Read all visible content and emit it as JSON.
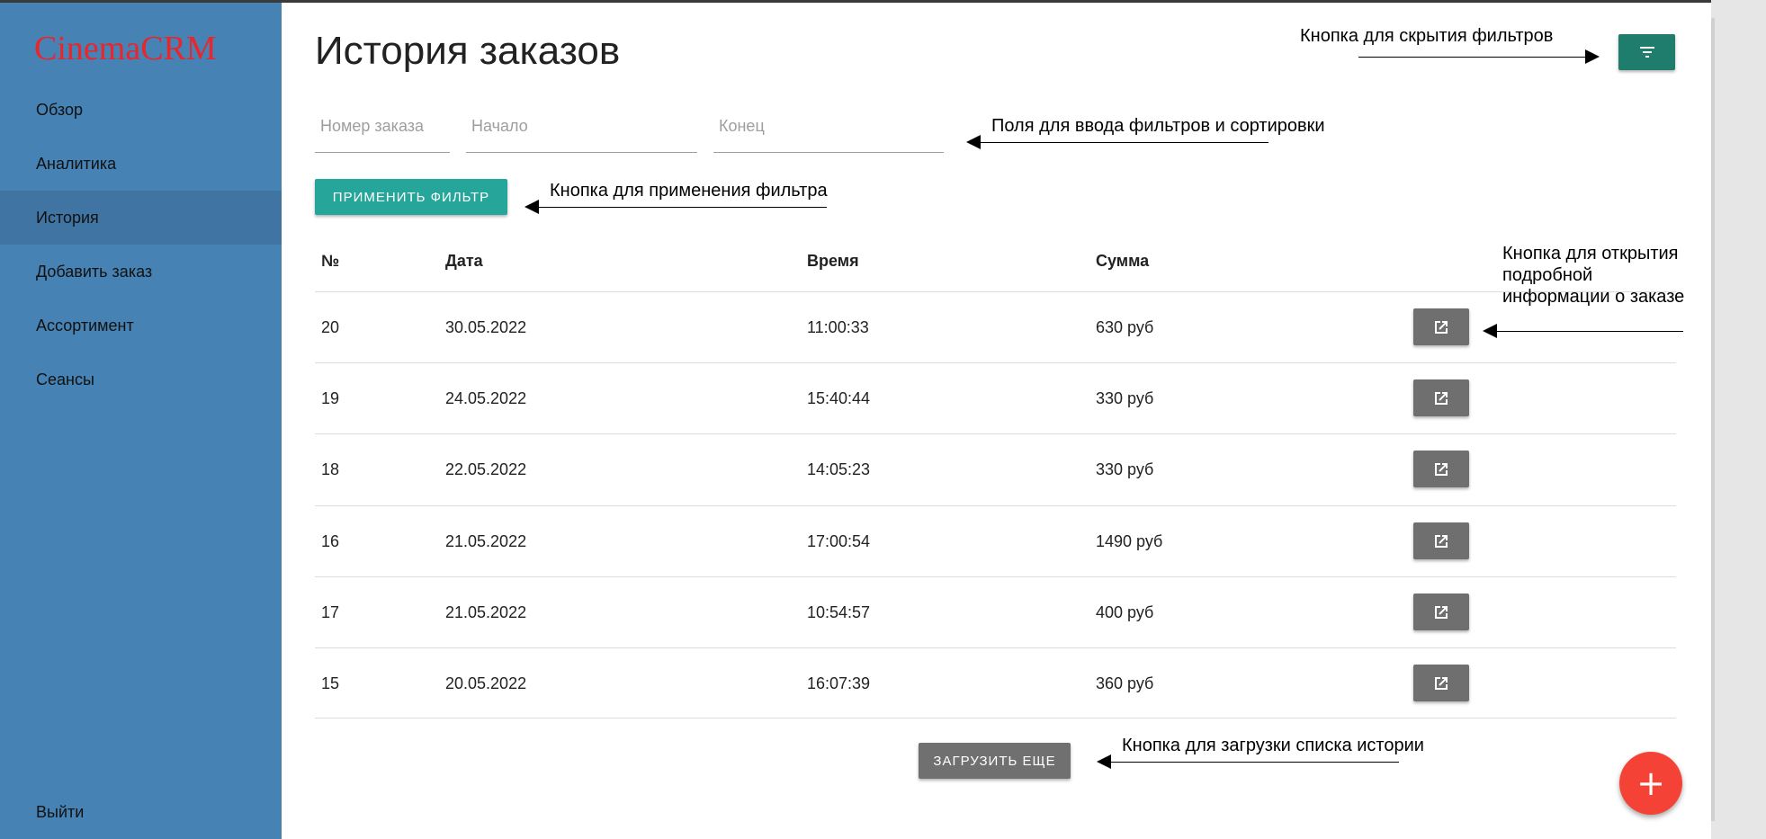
{
  "app": {
    "logo": "CinemaCRM"
  },
  "sidebar": {
    "items": [
      {
        "label": "Обзор"
      },
      {
        "label": "Аналитика"
      },
      {
        "label": "История",
        "active": true
      },
      {
        "label": "Добавить заказ"
      },
      {
        "label": "Ассортимент"
      },
      {
        "label": "Сеансы"
      }
    ],
    "logout": "Выйти"
  },
  "page": {
    "title": "История заказов"
  },
  "filters": {
    "order_number_placeholder": "Номер заказа",
    "start_placeholder": "Начало",
    "end_placeholder": "Конец",
    "apply_label": "ПРИМЕНИТЬ ФИЛЬТР",
    "toggle_icon": "filter-list-icon"
  },
  "table": {
    "headers": [
      "№",
      "Дата",
      "Время",
      "Сумма"
    ],
    "rows": [
      {
        "num": "20",
        "date": "30.05.2022",
        "time": "11:00:33",
        "sum": "630 руб"
      },
      {
        "num": "19",
        "date": "24.05.2022",
        "time": "15:40:44",
        "sum": "330 руб"
      },
      {
        "num": "18",
        "date": "22.05.2022",
        "time": "14:05:23",
        "sum": "330 руб"
      },
      {
        "num": "16",
        "date": "21.05.2022",
        "time": "17:00:54",
        "sum": "1490 руб"
      },
      {
        "num": "17",
        "date": "21.05.2022",
        "time": "10:54:57",
        "sum": "400 руб"
      },
      {
        "num": "15",
        "date": "20.05.2022",
        "time": "16:07:39",
        "sum": "360 руб"
      }
    ],
    "row_action_icon": "open-in-new-icon"
  },
  "load_more_label": "ЗАГРУЗИТЬ ЕЩЕ",
  "fab": {
    "label": "+",
    "icon": "add-icon"
  },
  "annotations": {
    "hide_filters": "Кнопка для скрытия фильтров",
    "filter_fields": "Поля для ввода фильтров и сортировки",
    "apply_filter": "Кнопка для применения фильтра",
    "open_details_1": "Кнопка для открытия",
    "open_details_2": "подробной",
    "open_details_3": "информации о заказе",
    "load_more": "Кнопка для загрузки списка истории"
  },
  "colors": {
    "sidebar": "#4682b4",
    "sidebar_active": "#3f74a3",
    "logo": "#e8262b",
    "apply_button": "#26a69a",
    "filter_button": "#1e7d6d",
    "grey_button": "#6f6f6f",
    "fab": "#f44336"
  }
}
